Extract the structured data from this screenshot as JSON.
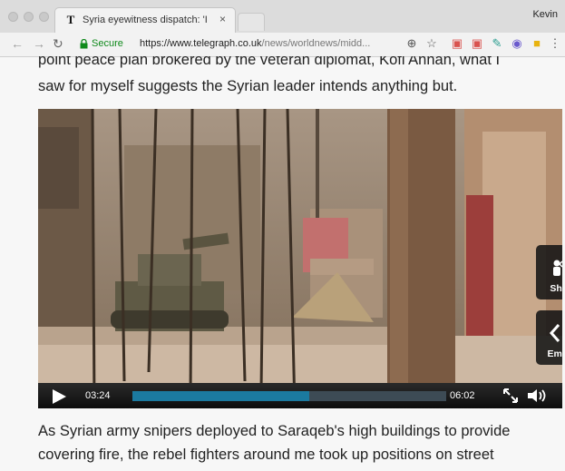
{
  "browser": {
    "tab_title": "Syria eyewitness dispatch: 'I w...",
    "tab_favicon": "T",
    "tab_close": "×",
    "profile_name": "Kevin",
    "secure_label": "Secure",
    "url_host": "https://www.telegraph.co.uk",
    "url_path": "/news/worldnews/midd...",
    "toolbar_icons": [
      "zoom-icon",
      "star-icon",
      "extension-icon",
      "extension-icon",
      "extension-icon",
      "extension-icon",
      "extension-icon",
      "menu-icon"
    ]
  },
  "article": {
    "para1_clipped": "point peace plan brokered by the veteran diplomat, Kofi Annan, what I",
    "para1_line2": "saw for myself suggests the Syrian leader intends anything but.",
    "para2_line1": "As Syrian army snipers deployed to Saraqeb's high buildings to provide",
    "para2_line2": "covering fire, the rebel fighters around me took up positions on street"
  },
  "video": {
    "time_current": "03:24",
    "time_total": "06:02",
    "progress_fraction": 0.564,
    "share_label": "Share",
    "embed_label": "Embed",
    "accent_color": "#1b7aa0"
  }
}
